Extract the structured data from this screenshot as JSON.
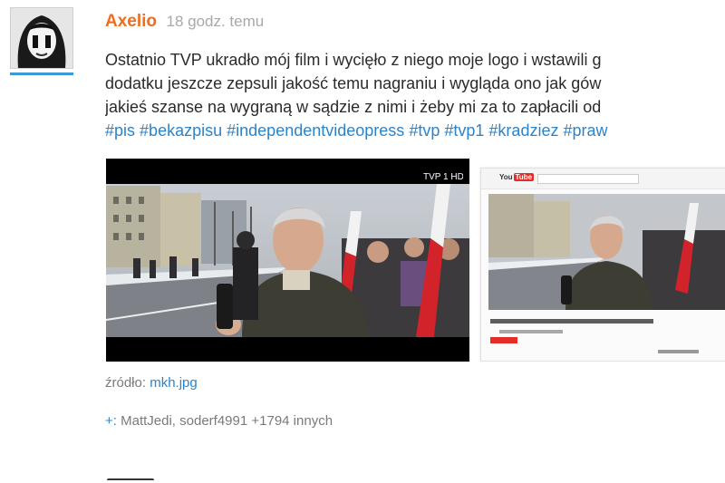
{
  "post": {
    "author": "Axelio",
    "time": "18 godz. temu",
    "lines": [
      "Ostatnio TVP ukradło mój film i wycięło z niego moje logo i wstawili g",
      "dodatku jeszcze zepsuli jakość temu nagraniu i wygląda ono jak gów",
      "jakieś szanse na wygraną w sądzie z nimi i żeby mi za to zapłacili od"
    ],
    "tags": [
      "#pis",
      "#bekazpisu",
      "#independentvideopress",
      "#tvp",
      "#tvp1",
      "#kradziez",
      "#praw"
    ],
    "tv_logo": "TVP 1 HD",
    "source_label": "źródło:",
    "source_link": "mkh.jpg",
    "plus_sign": "+:",
    "plus_users": "MattJedi, soderf4991",
    "plus_more": "+1794 innych"
  },
  "colors": {
    "author": "#f26b1d",
    "link": "#2d83c8",
    "avatar_underline": "#3a9bd9",
    "muted": "#a8a8a8"
  },
  "icons": {
    "youtube": "youtube-logo"
  }
}
